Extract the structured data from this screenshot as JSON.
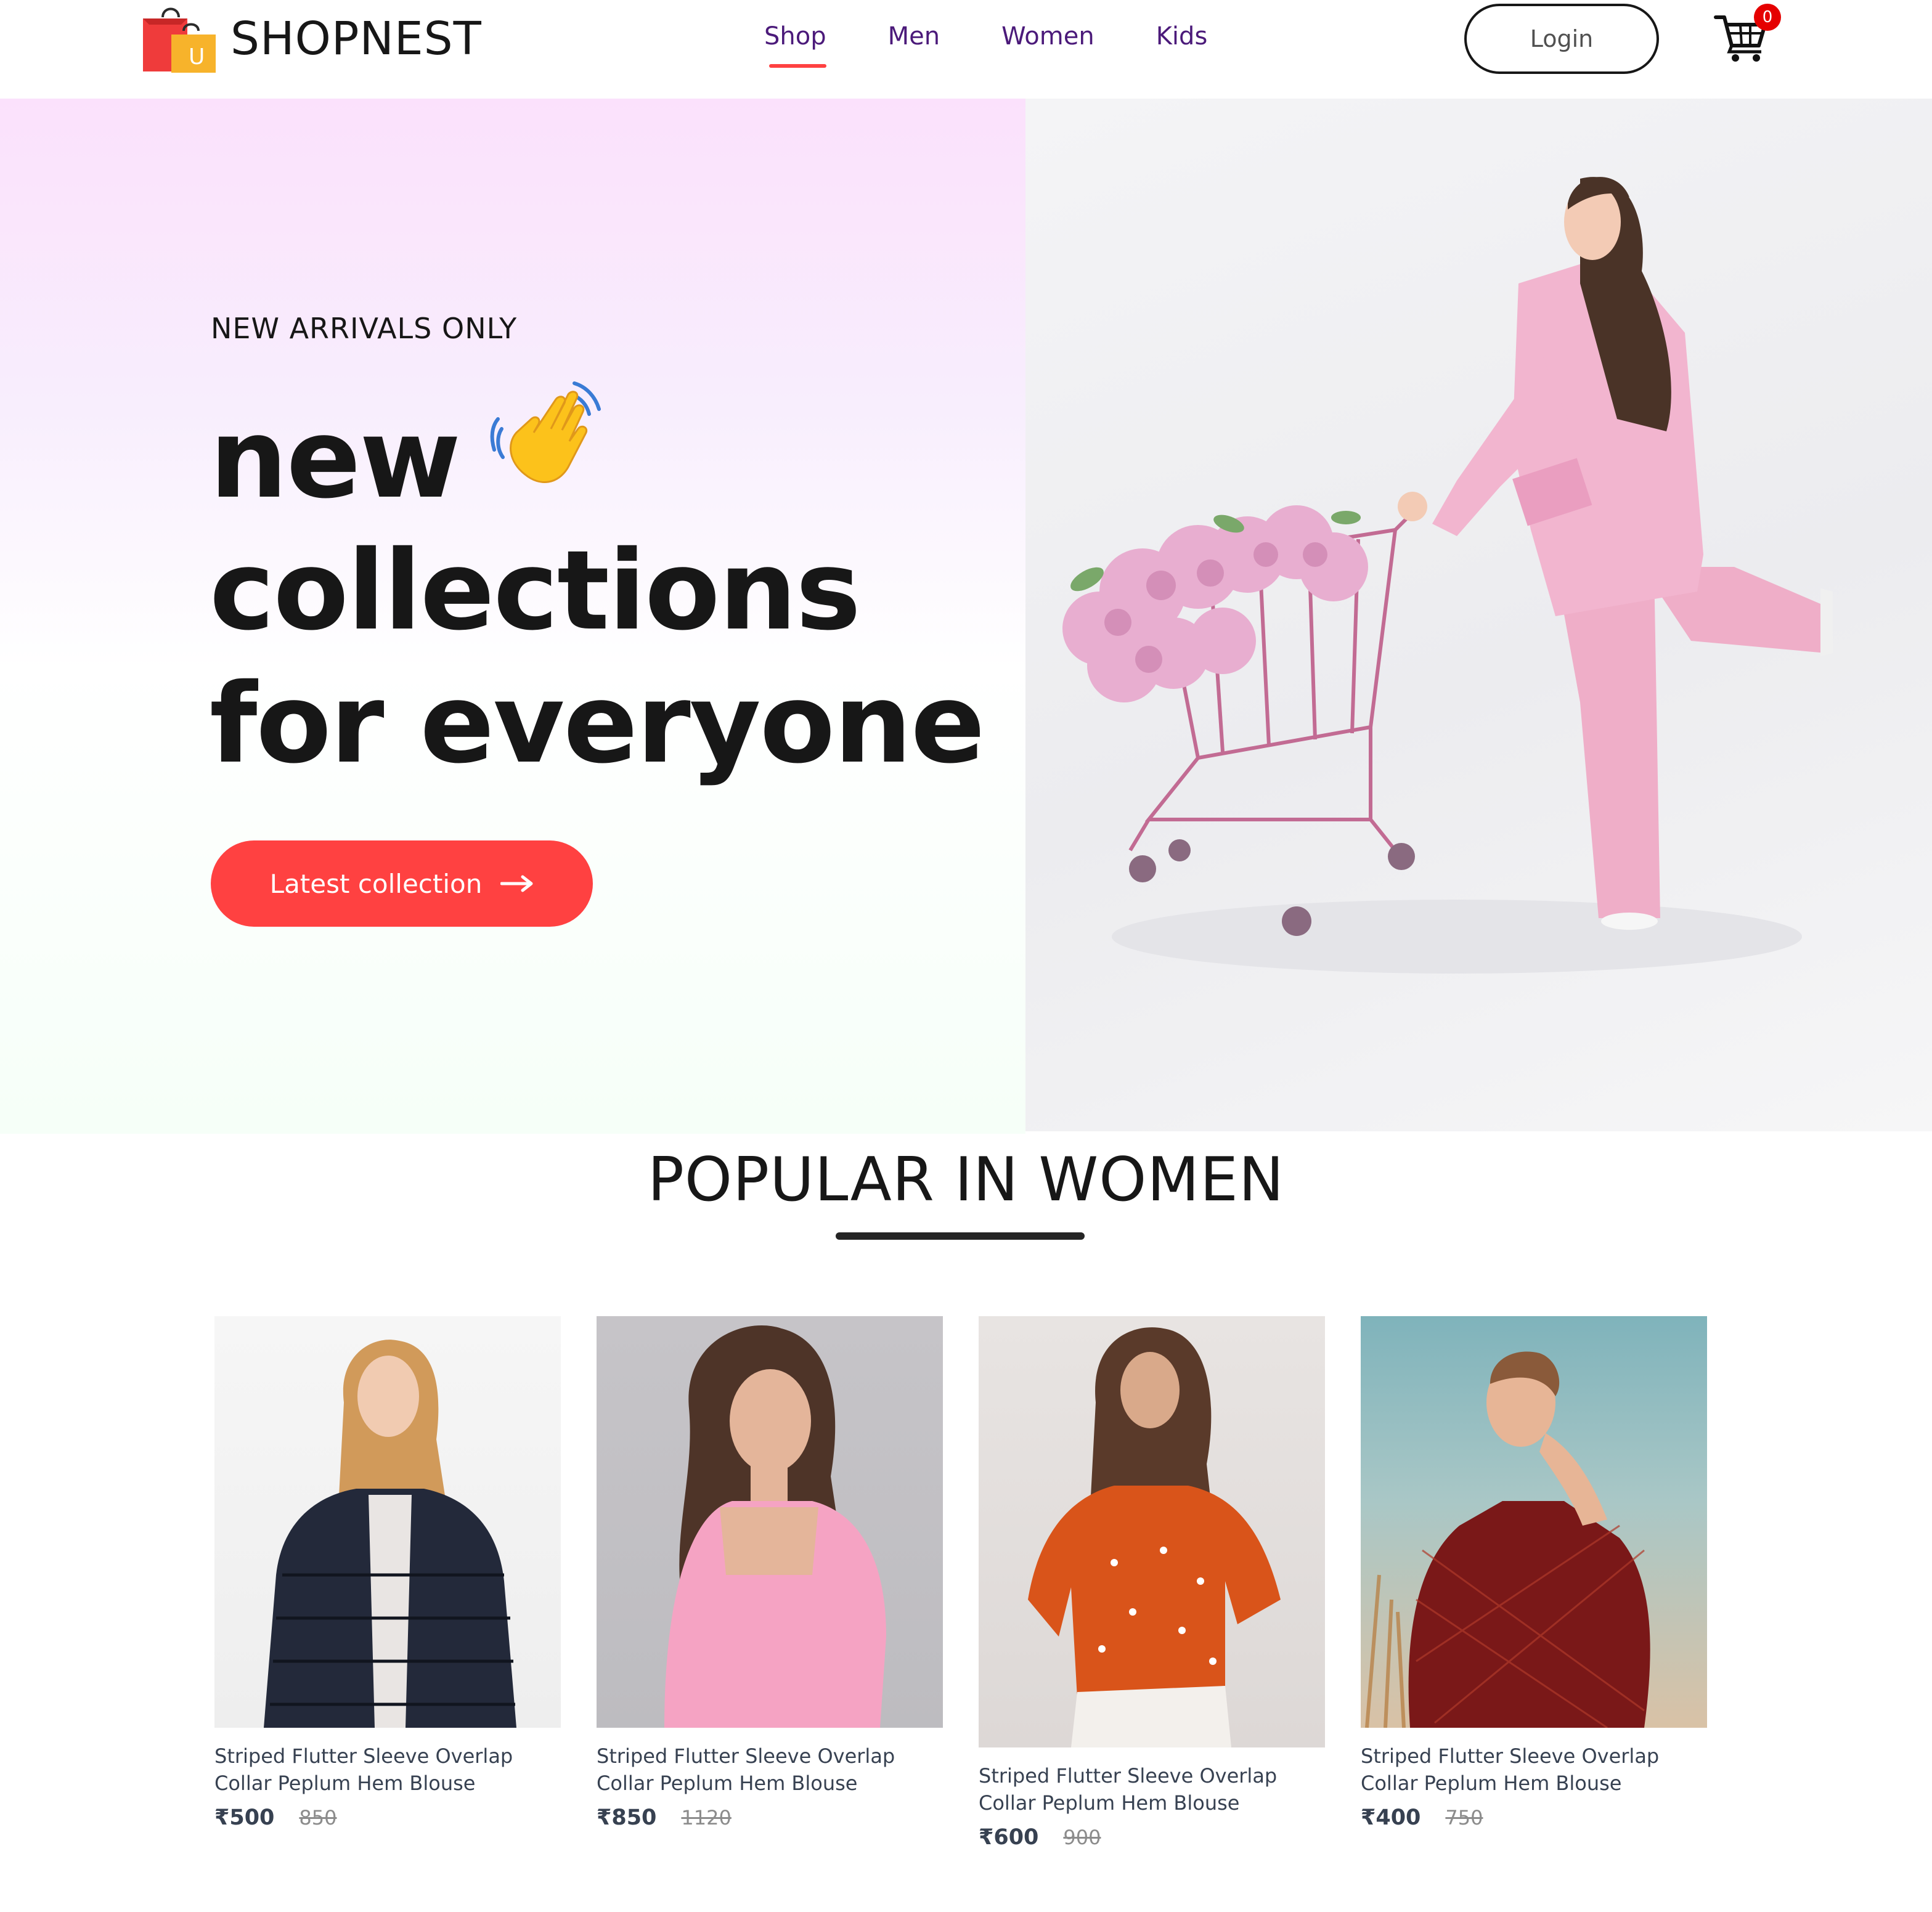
{
  "navbar": {
    "brand": "SHOPNEST",
    "logo_icon": "shopping-bag-icon",
    "menu": [
      {
        "label": "Shop",
        "active": true
      },
      {
        "label": "Men",
        "active": false
      },
      {
        "label": "Women",
        "active": false
      },
      {
        "label": "Kids",
        "active": false
      }
    ],
    "login_label": "Login",
    "cart_icon": "cart-icon",
    "cart_count": "0"
  },
  "hero": {
    "eyebrow": "NEW ARRIVALS ONLY",
    "line1": "new",
    "line2": "collections",
    "line3": "for everyone",
    "wave_icon": "waving-hand-icon",
    "button_label": "Latest collection",
    "button_icon": "arrow-right-icon",
    "image_alt": "hero-model-with-cart"
  },
  "popular": {
    "title": "POPULAR IN WOMEN",
    "products": [
      {
        "name": "Striped Flutter Sleeve Overlap Collar Peplum Hem Blouse",
        "new_price": "₹500",
        "old_price": "850"
      },
      {
        "name": "Striped Flutter Sleeve Overlap Collar Peplum Hem Blouse",
        "new_price": "₹850",
        "old_price": "1120"
      },
      {
        "name": "Striped Flutter Sleeve Overlap Collar Peplum Hem Blouse",
        "new_price": "₹600",
        "old_price": "900"
      },
      {
        "name": "Striped Flutter Sleeve Overlap Collar Peplum Hem Blouse",
        "new_price": "₹400",
        "old_price": "750"
      }
    ]
  },
  "colors": {
    "accent": "#ff4141",
    "nav_text": "#4b1a7a",
    "badge": "#e50000",
    "text": "#171717"
  }
}
